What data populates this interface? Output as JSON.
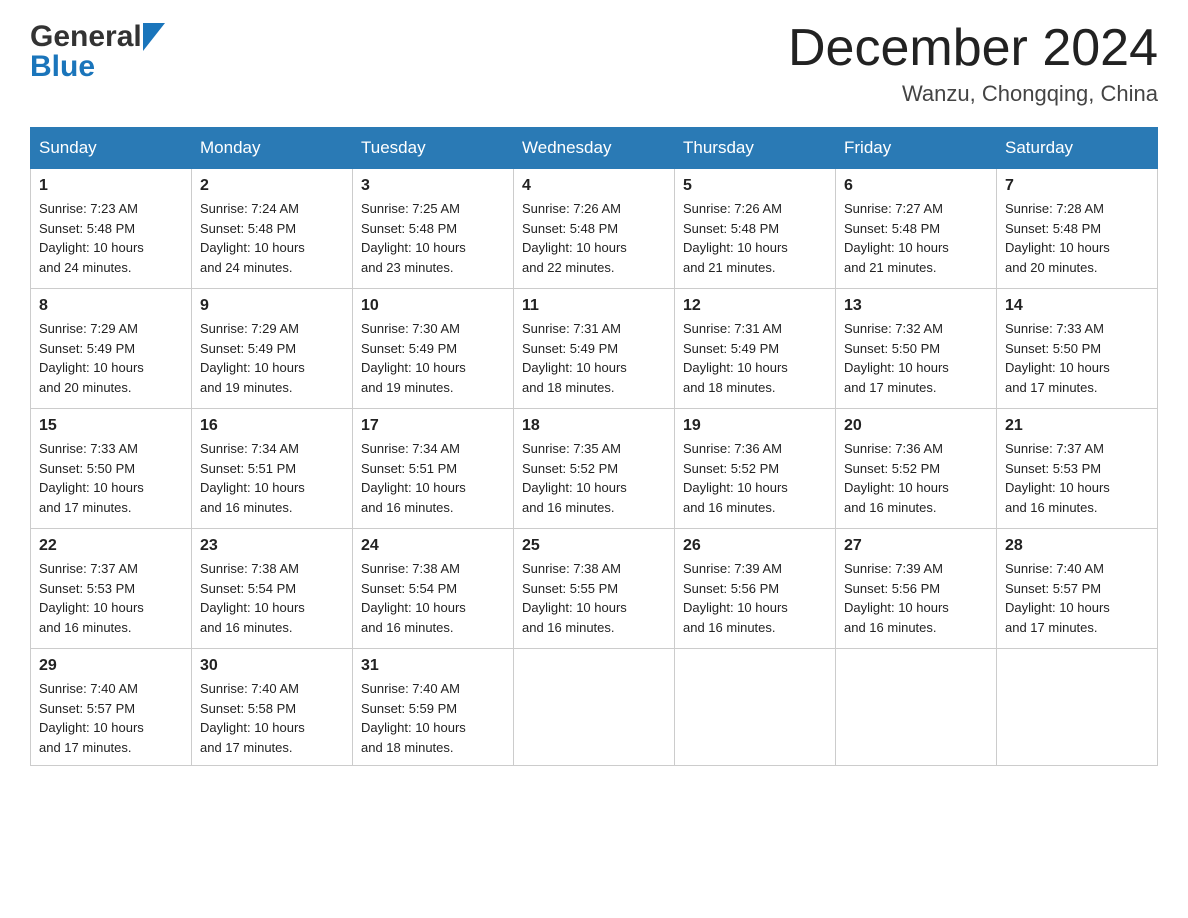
{
  "header": {
    "logo_general": "General",
    "logo_blue": "Blue",
    "month_title": "December 2024",
    "location": "Wanzu, Chongqing, China"
  },
  "days_of_week": [
    "Sunday",
    "Monday",
    "Tuesday",
    "Wednesday",
    "Thursday",
    "Friday",
    "Saturday"
  ],
  "weeks": [
    [
      {
        "day": "1",
        "sunrise": "7:23 AM",
        "sunset": "5:48 PM",
        "daylight": "10 hours and 24 minutes."
      },
      {
        "day": "2",
        "sunrise": "7:24 AM",
        "sunset": "5:48 PM",
        "daylight": "10 hours and 24 minutes."
      },
      {
        "day": "3",
        "sunrise": "7:25 AM",
        "sunset": "5:48 PM",
        "daylight": "10 hours and 23 minutes."
      },
      {
        "day": "4",
        "sunrise": "7:26 AM",
        "sunset": "5:48 PM",
        "daylight": "10 hours and 22 minutes."
      },
      {
        "day": "5",
        "sunrise": "7:26 AM",
        "sunset": "5:48 PM",
        "daylight": "10 hours and 21 minutes."
      },
      {
        "day": "6",
        "sunrise": "7:27 AM",
        "sunset": "5:48 PM",
        "daylight": "10 hours and 21 minutes."
      },
      {
        "day": "7",
        "sunrise": "7:28 AM",
        "sunset": "5:48 PM",
        "daylight": "10 hours and 20 minutes."
      }
    ],
    [
      {
        "day": "8",
        "sunrise": "7:29 AM",
        "sunset": "5:49 PM",
        "daylight": "10 hours and 20 minutes."
      },
      {
        "day": "9",
        "sunrise": "7:29 AM",
        "sunset": "5:49 PM",
        "daylight": "10 hours and 19 minutes."
      },
      {
        "day": "10",
        "sunrise": "7:30 AM",
        "sunset": "5:49 PM",
        "daylight": "10 hours and 19 minutes."
      },
      {
        "day": "11",
        "sunrise": "7:31 AM",
        "sunset": "5:49 PM",
        "daylight": "10 hours and 18 minutes."
      },
      {
        "day": "12",
        "sunrise": "7:31 AM",
        "sunset": "5:49 PM",
        "daylight": "10 hours and 18 minutes."
      },
      {
        "day": "13",
        "sunrise": "7:32 AM",
        "sunset": "5:50 PM",
        "daylight": "10 hours and 17 minutes."
      },
      {
        "day": "14",
        "sunrise": "7:33 AM",
        "sunset": "5:50 PM",
        "daylight": "10 hours and 17 minutes."
      }
    ],
    [
      {
        "day": "15",
        "sunrise": "7:33 AM",
        "sunset": "5:50 PM",
        "daylight": "10 hours and 17 minutes."
      },
      {
        "day": "16",
        "sunrise": "7:34 AM",
        "sunset": "5:51 PM",
        "daylight": "10 hours and 16 minutes."
      },
      {
        "day": "17",
        "sunrise": "7:34 AM",
        "sunset": "5:51 PM",
        "daylight": "10 hours and 16 minutes."
      },
      {
        "day": "18",
        "sunrise": "7:35 AM",
        "sunset": "5:52 PM",
        "daylight": "10 hours and 16 minutes."
      },
      {
        "day": "19",
        "sunrise": "7:36 AM",
        "sunset": "5:52 PM",
        "daylight": "10 hours and 16 minutes."
      },
      {
        "day": "20",
        "sunrise": "7:36 AM",
        "sunset": "5:52 PM",
        "daylight": "10 hours and 16 minutes."
      },
      {
        "day": "21",
        "sunrise": "7:37 AM",
        "sunset": "5:53 PM",
        "daylight": "10 hours and 16 minutes."
      }
    ],
    [
      {
        "day": "22",
        "sunrise": "7:37 AM",
        "sunset": "5:53 PM",
        "daylight": "10 hours and 16 minutes."
      },
      {
        "day": "23",
        "sunrise": "7:38 AM",
        "sunset": "5:54 PM",
        "daylight": "10 hours and 16 minutes."
      },
      {
        "day": "24",
        "sunrise": "7:38 AM",
        "sunset": "5:54 PM",
        "daylight": "10 hours and 16 minutes."
      },
      {
        "day": "25",
        "sunrise": "7:38 AM",
        "sunset": "5:55 PM",
        "daylight": "10 hours and 16 minutes."
      },
      {
        "day": "26",
        "sunrise": "7:39 AM",
        "sunset": "5:56 PM",
        "daylight": "10 hours and 16 minutes."
      },
      {
        "day": "27",
        "sunrise": "7:39 AM",
        "sunset": "5:56 PM",
        "daylight": "10 hours and 16 minutes."
      },
      {
        "day": "28",
        "sunrise": "7:40 AM",
        "sunset": "5:57 PM",
        "daylight": "10 hours and 17 minutes."
      }
    ],
    [
      {
        "day": "29",
        "sunrise": "7:40 AM",
        "sunset": "5:57 PM",
        "daylight": "10 hours and 17 minutes."
      },
      {
        "day": "30",
        "sunrise": "7:40 AM",
        "sunset": "5:58 PM",
        "daylight": "10 hours and 17 minutes."
      },
      {
        "day": "31",
        "sunrise": "7:40 AM",
        "sunset": "5:59 PM",
        "daylight": "10 hours and 18 minutes."
      },
      null,
      null,
      null,
      null
    ]
  ],
  "labels": {
    "sunrise": "Sunrise:",
    "sunset": "Sunset:",
    "daylight": "Daylight:"
  }
}
